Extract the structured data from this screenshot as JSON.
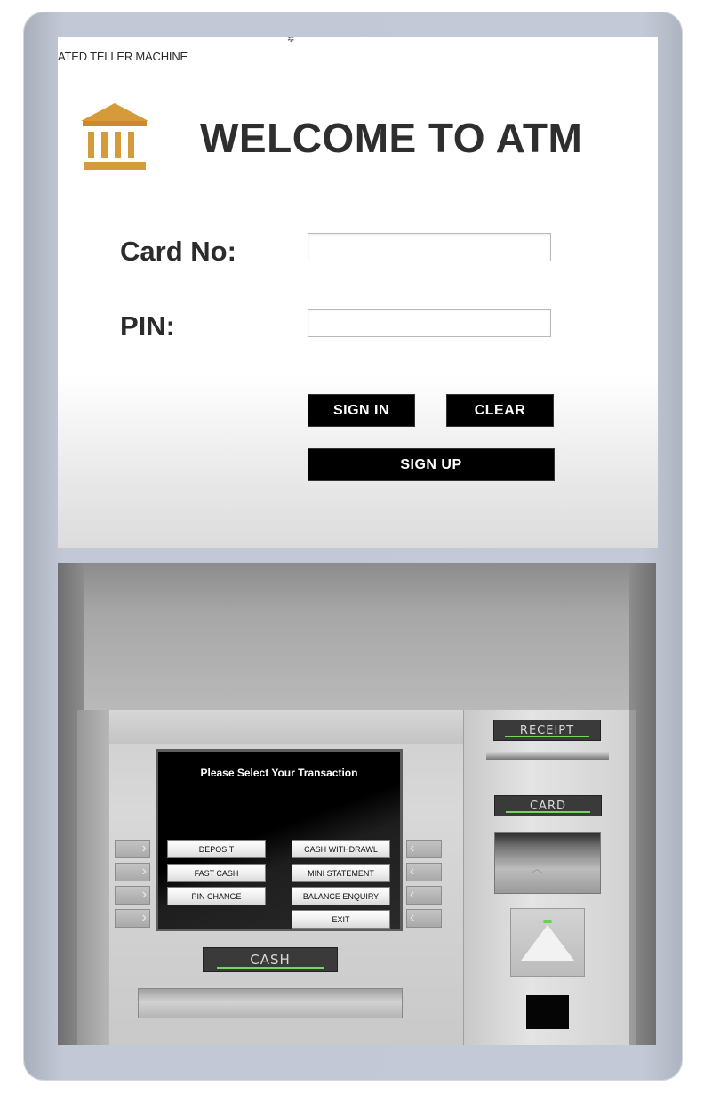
{
  "window": {
    "title": "ATED TELLER MACHINE",
    "heading": "WELCOME TO ATM"
  },
  "login": {
    "card_label": "Card No:",
    "card_value": "",
    "pin_label": "PIN:",
    "pin_value": "",
    "sign_in": "SIGN IN",
    "clear": "CLEAR",
    "sign_up": "SIGN UP"
  },
  "atm": {
    "screen_title": "Please Select Your Transaction",
    "buttons_left": [
      "DEPOSIT",
      "FAST CASH",
      "PIN CHANGE"
    ],
    "buttons_right": [
      "CASH WITHDRAWL",
      "MINI STATEMENT",
      "BALANCE ENQUIRY",
      "EXIT"
    ],
    "receipt_label": "RECEIPT",
    "card_label": "CARD",
    "cash_label": "CASH"
  },
  "icons": {
    "logo": "bank-building-icon",
    "side_keys_left": "chevron-right-icon",
    "side_keys_right": "chevron-left-icon"
  },
  "colors": {
    "logo_gold": "#d59a3a",
    "button_black": "#000000",
    "indicator_green": "#74d65a"
  }
}
